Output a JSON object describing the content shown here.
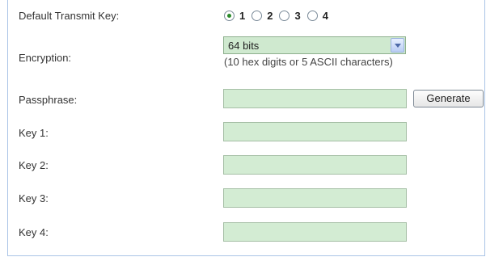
{
  "transmit_key": {
    "label": "Default Transmit Key:",
    "options": [
      "1",
      "2",
      "3",
      "4"
    ],
    "selected": "1"
  },
  "encryption": {
    "label": "Encryption:",
    "selected": "64 bits",
    "hint": "(10 hex digits or 5 ASCII characters)"
  },
  "passphrase": {
    "label": "Passphrase:",
    "value": "",
    "generate_label": "Generate"
  },
  "keys": [
    {
      "label": "Key 1:",
      "value": ""
    },
    {
      "label": "Key 2:",
      "value": ""
    },
    {
      "label": "Key 3:",
      "value": ""
    },
    {
      "label": "Key 4:",
      "value": ""
    }
  ],
  "colors": {
    "field_bg": "#d3ecd3",
    "border": "#aac4e6",
    "radio_checked": "#2a8a2a"
  }
}
